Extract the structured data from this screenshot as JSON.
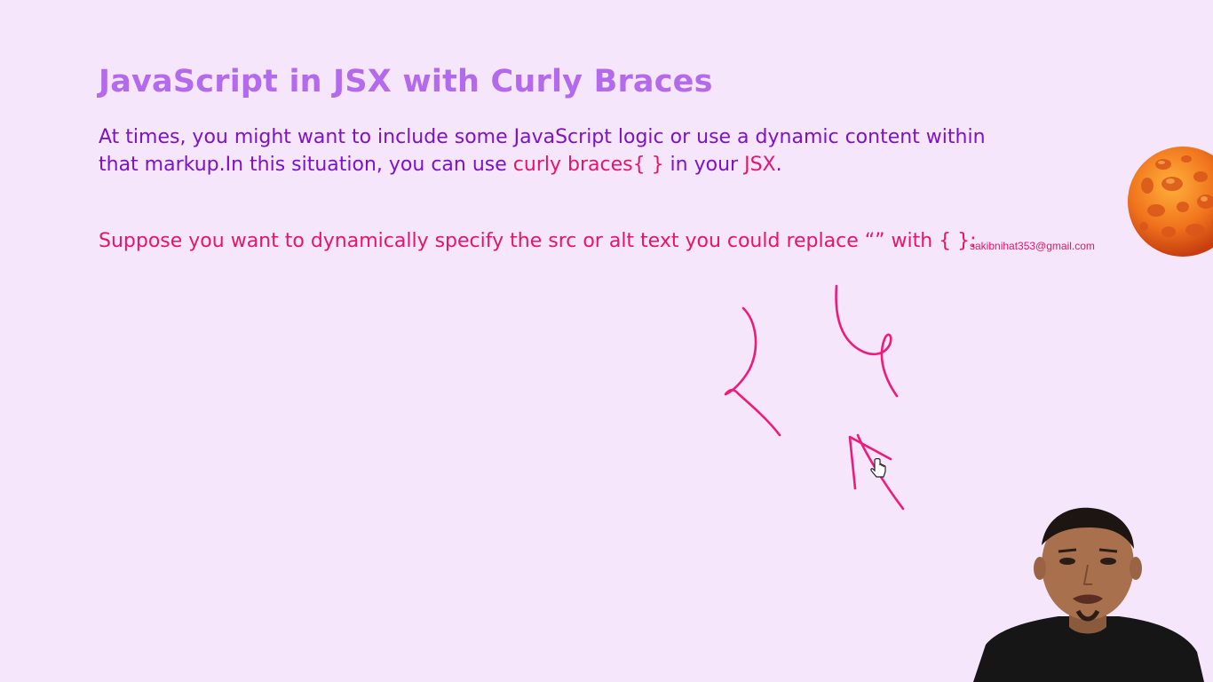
{
  "slide": {
    "title": "JavaScript in JSX with Curly Braces",
    "paragraph": {
      "line1": "At times, you might want to include some JavaScript logic or use a dynamic content within",
      "line2_start": "that markup.In this situation, you can use ",
      "highlight1": "curly braces{ }",
      "middle": " in your ",
      "highlight2": "JSX",
      "end": "."
    },
    "note": "Suppose you want to dynamically specify the src or alt text you could replace “” with { }:",
    "watermark": "sakibnihat353@gmail.com"
  },
  "colors": {
    "background": "#f5e6fb",
    "title": "#b46aec",
    "body_text": "#7e12c9",
    "highlight": "#e8136e",
    "ink": "#ee1b7a"
  },
  "icons": {
    "planet": "planet-icon",
    "cursor": "hand-cursor-icon"
  }
}
